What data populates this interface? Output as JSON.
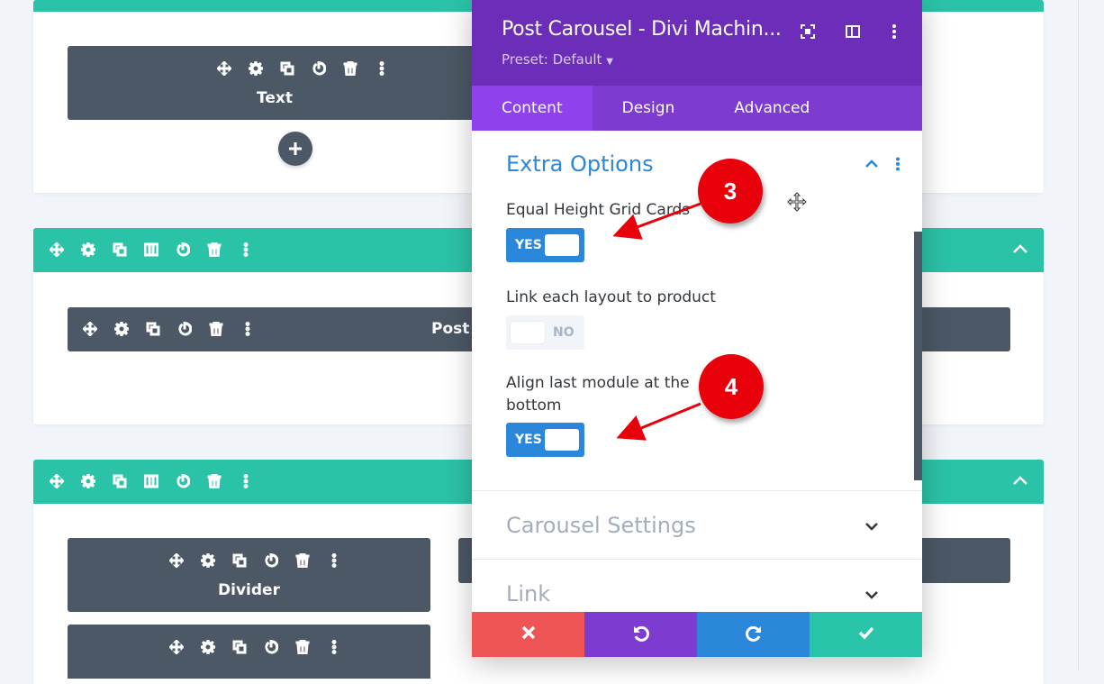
{
  "builder": {
    "text_module_label": "Text",
    "post_module_label": "Post C",
    "divider_module_label": "Divider"
  },
  "modal": {
    "title": "Post Carousel - Divi Machin...",
    "preset": "Preset: Default",
    "tabs": [
      "Content",
      "Design",
      "Advanced"
    ],
    "section_title": "Extra Options",
    "options": [
      {
        "label": "Equal Height Grid Cards",
        "value": "YES"
      },
      {
        "label": "Link each layout to product",
        "value": "NO"
      },
      {
        "label": "Align last module at the bottom",
        "value": "YES"
      }
    ],
    "collapsed_sections": [
      "Carousel Settings",
      "Link"
    ]
  },
  "annotations": {
    "badge_3": "3",
    "badge_4": "4"
  },
  "colors": {
    "purple_header": "#6c2eb9",
    "tab_bar": "#7e3bd0",
    "teal": "#2bc3a8",
    "module_dark": "#4c5866",
    "toggle_blue": "#2b87da",
    "cancel": "#ef5555",
    "undo": "#7e3bd0",
    "redo": "#2b87da",
    "save": "#29c4a9",
    "badge_red": "#e8000b"
  },
  "icons": [
    "move-icon",
    "gear-icon",
    "duplicate-icon",
    "columns-icon",
    "power-icon",
    "trash-icon",
    "more-icon",
    "plus-icon",
    "chevron-up-icon",
    "chevron-down-icon",
    "fullscreen-icon",
    "sidebar-icon",
    "close-icon",
    "undo-icon",
    "redo-icon",
    "check-icon"
  ]
}
